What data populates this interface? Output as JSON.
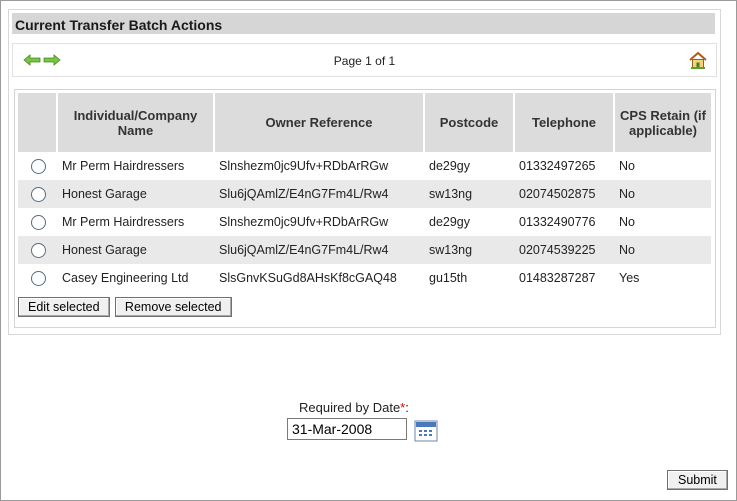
{
  "panel": {
    "title": "Current Transfer Batch Actions",
    "pager": {
      "label": "Page 1 of 1",
      "prev_icon": "left-arrow-icon",
      "next_icon": "right-arrow-icon",
      "home_icon": "home-icon",
      "arrow_color": "#6fbf3a"
    }
  },
  "table": {
    "columns": [
      "Individual/Company Name",
      "Owner Reference",
      "Postcode",
      "Telephone",
      "CPS Retain (if applicable)"
    ],
    "rows": [
      {
        "name": "Mr Perm Hairdressers",
        "ref": "Slnshezm0jc9Ufv+RDbArRGw",
        "postcode": "de29gy",
        "telephone": "01332497265",
        "retain": "No"
      },
      {
        "name": "Honest Garage",
        "ref": "Slu6jQAmlZ/E4nG7Fm4L/Rw4",
        "postcode": "sw13ng",
        "telephone": "02074502875",
        "retain": "No"
      },
      {
        "name": "Mr Perm Hairdressers",
        "ref": "Slnshezm0jc9Ufv+RDbArRGw",
        "postcode": "de29gy",
        "telephone": "01332490776",
        "retain": "No"
      },
      {
        "name": "Honest Garage",
        "ref": "Slu6jQAmlZ/E4nG7Fm4L/Rw4",
        "postcode": "sw13ng",
        "telephone": "02074539225",
        "retain": "No"
      },
      {
        "name": "Casey Engineering Ltd",
        "ref": "SlsGnvKSuGd8AHsKf8cGAQ48",
        "postcode": "gu15th",
        "telephone": "01483287287",
        "retain": "Yes"
      }
    ]
  },
  "actions": {
    "edit_label": "Edit selected",
    "remove_label": "Remove selected"
  },
  "date": {
    "label": "Required by Date",
    "required_marker": "*",
    "label_suffix": ":",
    "value": "31-Mar-2008",
    "calendar_icon": "calendar-icon"
  },
  "submit_label": "Submit"
}
